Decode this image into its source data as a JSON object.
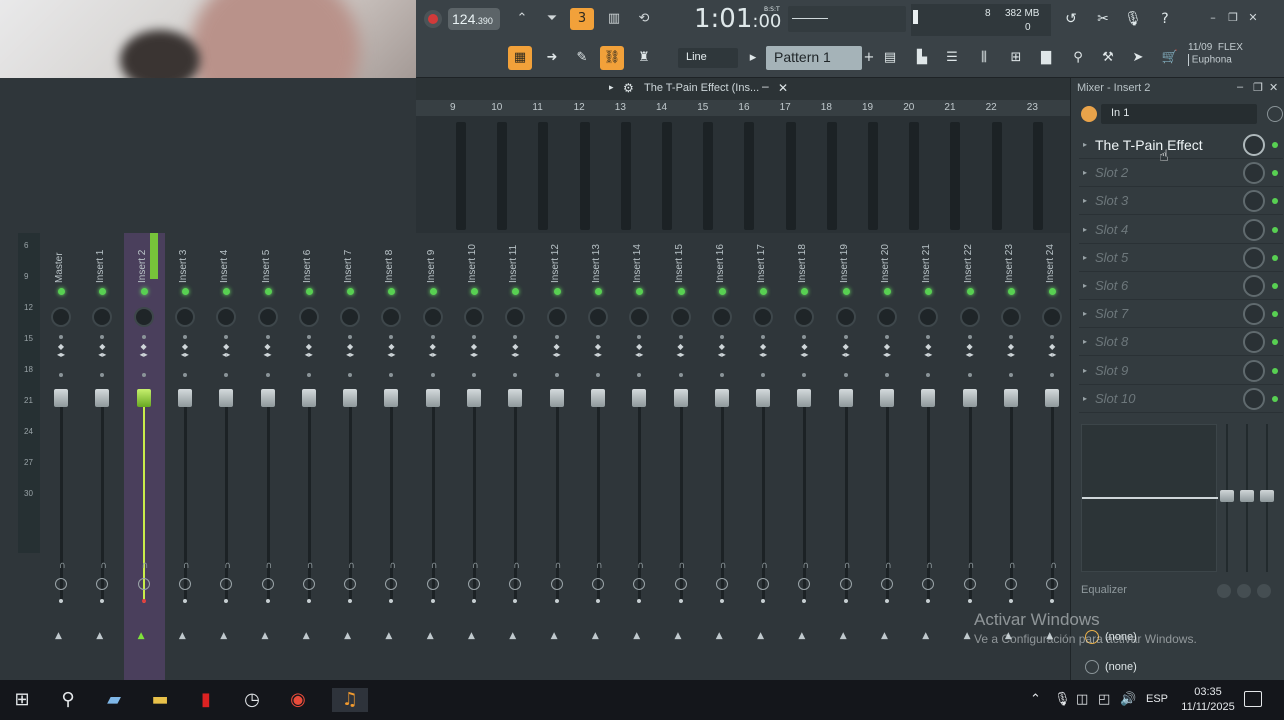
{
  "toolbar": {
    "tempo_main": "124",
    "tempo_frac": ".390",
    "clock_main": "1:01",
    "clock_sub": ":00",
    "clock_tiny": "B:S:T",
    "memory_mb": "382 MB",
    "cpu_count": "8",
    "poly_count": "0",
    "snap_mode": "Line",
    "pattern": "Pattern 1",
    "hint_line1": "11/09",
    "hint_brand": "FLEX",
    "hint_line2": "Euphona"
  },
  "mixer": {
    "title": "The T-Pain Effect (Ins...",
    "ruler": [
      "9",
      "10",
      "11",
      "12",
      "13",
      "14",
      "15",
      "16",
      "17",
      "18",
      "19",
      "20",
      "21",
      "22",
      "23"
    ],
    "scale": [
      "6",
      "9",
      "12",
      "15",
      "18",
      "21",
      "24",
      "27",
      "30"
    ],
    "tracks": [
      "Master",
      "Insert 1",
      "Insert 2",
      "Insert 3",
      "Insert 4",
      "Insert 5",
      "Insert 6",
      "Insert 7",
      "Insert 8",
      "Insert 9",
      "Insert 10",
      "Insert 11",
      "Insert 12",
      "Insert 13",
      "Insert 14",
      "Insert 15",
      "Insert 16",
      "Insert 17",
      "Insert 18",
      "Insert 19",
      "Insert 20",
      "Insert 21",
      "Insert 22",
      "Insert 23",
      "Insert 24"
    ],
    "selected_track": "Insert 2"
  },
  "panel": {
    "title": "Mixer - Insert 2",
    "input": "In 1",
    "slots": [
      "The T-Pain Effect",
      "Slot 2",
      "Slot 3",
      "Slot 4",
      "Slot 5",
      "Slot 6",
      "Slot 7",
      "Slot 8",
      "Slot 9",
      "Slot 10"
    ],
    "eq_label": "Equalizer",
    "out1": "(none)",
    "out2": "(none)"
  },
  "watermark": {
    "line1": "Activar Windows",
    "line2": "Ve a Configuración para activar Windows."
  },
  "taskbar": {
    "lang": "ESP",
    "time": "03:35",
    "date": "11/11/2025"
  }
}
